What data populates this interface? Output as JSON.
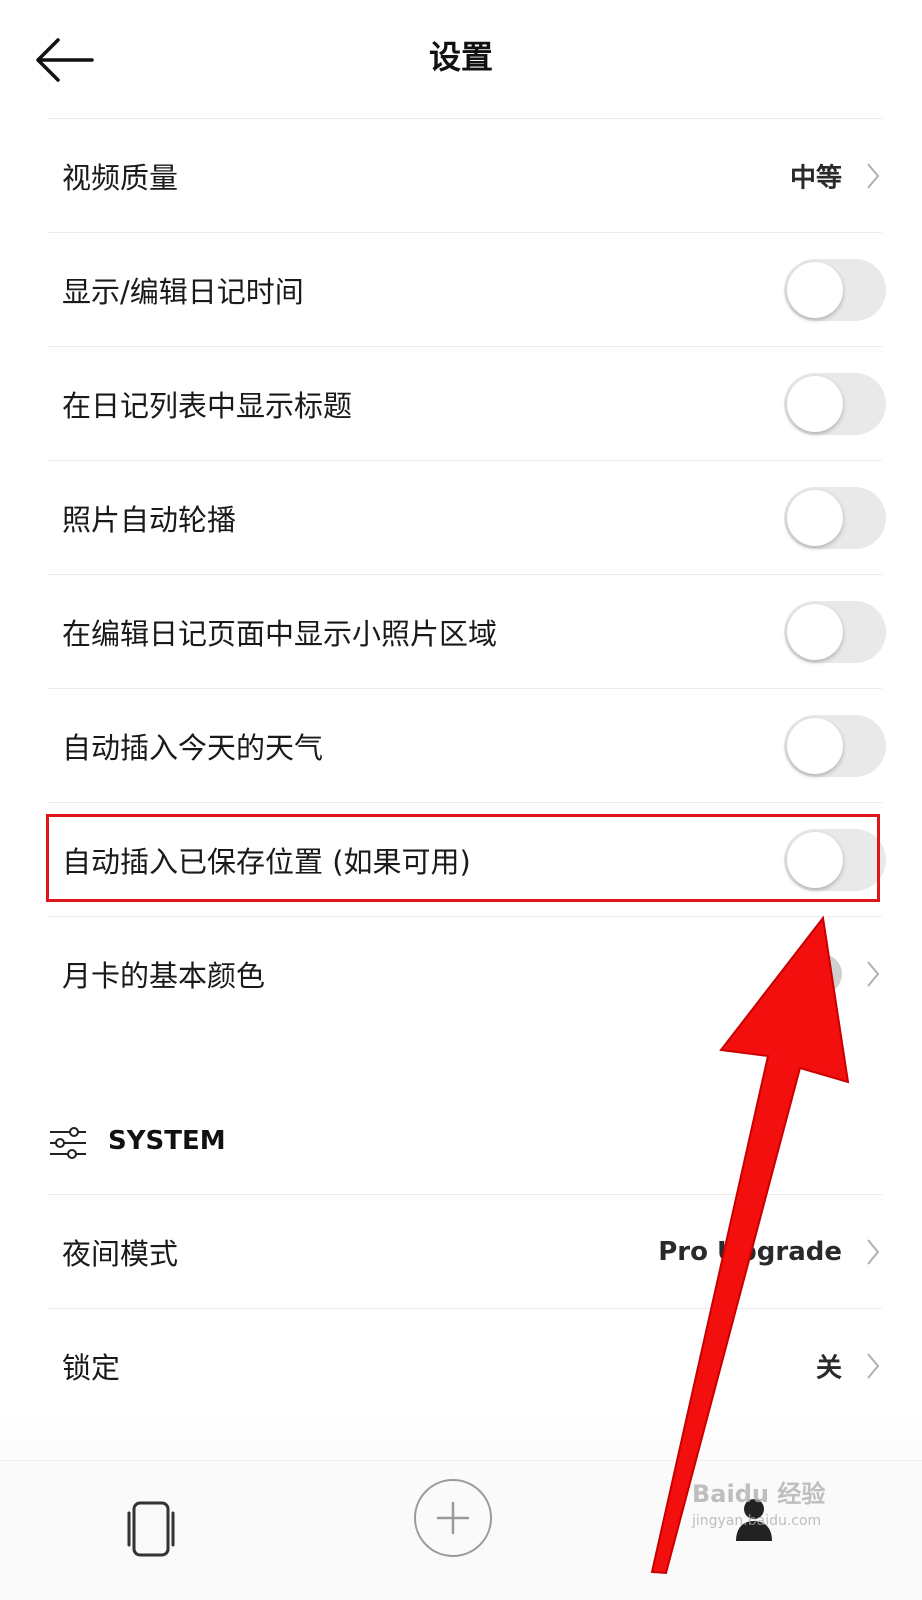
{
  "header": {
    "title": "设置"
  },
  "rows": [
    {
      "label": "视频质量",
      "value": "中等"
    },
    {
      "label": "显示/编辑日记时间"
    },
    {
      "label": "在日记列表中显示标题"
    },
    {
      "label": "照片自动轮播"
    },
    {
      "label": "在编辑日记页面中显示小照片区域"
    },
    {
      "label": "自动插入今天的天气"
    },
    {
      "label": "自动插入已保存位置 (如果可用)"
    },
    {
      "label": "月卡的基本颜色"
    }
  ],
  "toggles": {
    "show_edit_time": false,
    "show_title": false,
    "photo_autoplay": false,
    "small_photo_area": false,
    "auto_weather": false,
    "auto_location": false
  },
  "system": {
    "title": "SYSTEM",
    "rows": [
      {
        "label": "夜间模式",
        "value": "Pro Upgrade"
      },
      {
        "label": "锁定",
        "value": "关"
      }
    ]
  },
  "watermark": {
    "brand": "Baidu 经验",
    "url": "jingyan.baidu.com"
  },
  "colors": {
    "annotation": "#e0141b",
    "toggle_off": "#e9e9ea"
  },
  "icons": {
    "back": "arrow-left-icon",
    "chevron": "chevron-right-icon",
    "settings": "sliders-icon",
    "cards": "cards-icon",
    "add": "plus-circle-icon",
    "profile": "person-icon"
  }
}
